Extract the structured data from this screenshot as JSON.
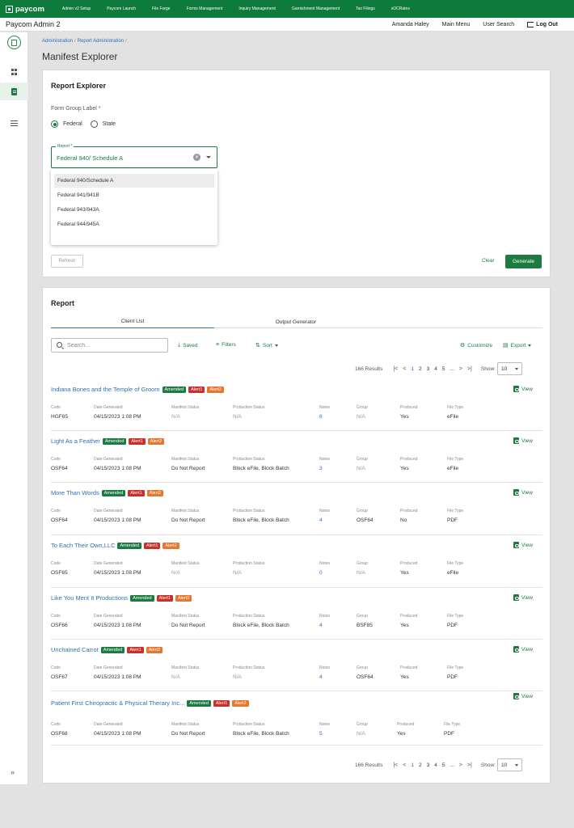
{
  "topnav": {
    "brand": "paycom",
    "links": [
      "Admin v2 Setup",
      "Paycom Launch",
      "File Forge",
      "Forms Management",
      "Inquiry Management",
      "Garnishment Management",
      "Tax Filings",
      "sOCRates"
    ]
  },
  "header": {
    "app_title": "Paycom Admin 2",
    "user": "Amanda Haley",
    "main_menu": "Main Menu",
    "user_search": "User Search",
    "logout": "Log Out"
  },
  "breadcrumb": {
    "items": [
      "Administration",
      "Report Administration"
    ]
  },
  "page_title": "Manifest Explorer",
  "explorer": {
    "title": "Report Explorer",
    "form_group_label": "Form Group Label",
    "required_mark": "*",
    "radios": [
      {
        "label": "Federal",
        "checked": true
      },
      {
        "label": "State",
        "checked": false
      }
    ],
    "report_label": "Report *",
    "report_value": "Federal 940/ Schedule A",
    "options": [
      "Federal 940/Schedule A",
      "Federal 941/941B",
      "Federal 943/943A",
      "Federal 944/945A"
    ],
    "refresh": "Refresh",
    "clear": "Clear",
    "generate": "Generate"
  },
  "report": {
    "title": "Report",
    "tabs": [
      "Client List",
      "Output Generator"
    ],
    "search_placeholder": "Search...",
    "saved": "Saved",
    "filters": "Filters",
    "sort": "Sort",
    "customize": "Customize",
    "export": "Export",
    "results": "166 Results",
    "pages": [
      "1",
      "2",
      "3",
      "4",
      "5",
      "..."
    ],
    "show_label": "Show:",
    "show_value": "10",
    "view": "View",
    "columns": [
      "Code",
      "Date Generated",
      "Manifest Status",
      "Production Status",
      "Notes",
      "Group",
      "Produced",
      "File Type"
    ],
    "badges": {
      "amended": "Amended",
      "alert1": "Alert1",
      "alert2": "Alert2"
    },
    "rows": [
      {
        "name": "Indiana Bones and the Temple of Groom",
        "code": "HGF65",
        "date": "04/15/2023 1:08 PM",
        "manifest": "N/A",
        "production": "N/A",
        "notes": "8",
        "group": "N/A",
        "produced": "Yes",
        "filetype": "eFile"
      },
      {
        "name": "Light As a Feather",
        "code": "OSF64",
        "date": "04/15/2023 1:08 PM",
        "manifest": "Do Not Report",
        "production": "Block eFile, Block Batch",
        "notes": "3",
        "group": "N/A",
        "produced": "Yes",
        "filetype": "eFile"
      },
      {
        "name": "More Than Words",
        "code": "OSF64",
        "date": "04/15/2023 1:08 PM",
        "manifest": "Do Not Report",
        "production": "Block eFile, Block Batch",
        "notes": "4",
        "group": "OSF64",
        "produced": "No",
        "filetype": "PDF"
      },
      {
        "name": "To Each Their Own,LLC",
        "code": "OSF65",
        "date": "04/15/2023 1:08 PM",
        "manifest": "N/A",
        "production": "N/A",
        "notes": "0",
        "group": "N/A",
        "produced": "Yes",
        "filetype": "eFile"
      },
      {
        "name": "Like You Ment It Productions",
        "code": "OSF66",
        "date": "04/15/2023 1:08 PM",
        "manifest": "Do Not Report",
        "production": "Block eFile, Block Batch",
        "notes": "4",
        "group": "BSF85",
        "produced": "Yes",
        "filetype": "PDF"
      },
      {
        "name": "Unchained Carrot",
        "code": "OSF67",
        "date": "04/15/2023 1:08 PM",
        "manifest": "N/A",
        "production": "N/A",
        "notes": "4",
        "group": "OSF64",
        "produced": "Yes",
        "filetype": "PDF"
      },
      {
        "name": "Patient First Chiropractic & Physical Therary Inc...",
        "code": "OSF68",
        "date": "04/15/2023 1:08 PM",
        "manifest": "Do Not Report",
        "production": "Block eFile, Block Batch",
        "notes": "5",
        "group": "N/A",
        "produced": "Yes",
        "filetype": "PDF"
      }
    ]
  }
}
